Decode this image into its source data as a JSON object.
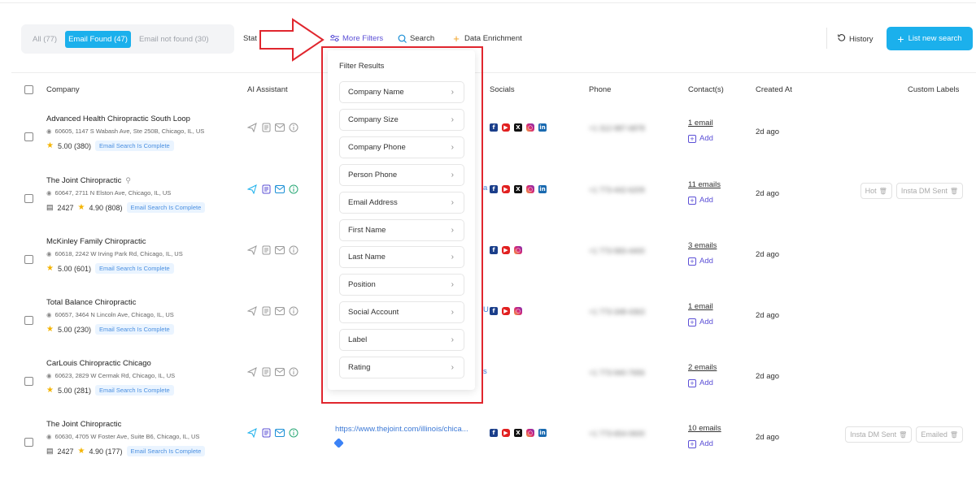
{
  "tabs": [
    {
      "label": "All (77)",
      "active": false
    },
    {
      "label": "Email Found (47)",
      "active": true
    },
    {
      "label": "Email not found (30)",
      "active": false
    }
  ],
  "status_label": "Stat",
  "toolbar": {
    "more_filters": "More Filters",
    "search": "Search",
    "data_enrichment": "Data Enrichment",
    "history": "History",
    "list_new_search": "List new search"
  },
  "columns": {
    "company": "Company",
    "ai_assistant": "AI Assistant",
    "socials": "Socials",
    "phone": "Phone",
    "contacts": "Contact(s)",
    "created_at": "Created At",
    "custom_labels": "Custom Labels"
  },
  "filter_panel": {
    "title": "Filter Results",
    "items": [
      "Company Name",
      "Company Size",
      "Company Phone",
      "Person Phone",
      "Email Address",
      "First Name",
      "Last Name",
      "Position",
      "Social Account",
      "Label",
      "Rating"
    ]
  },
  "rows": [
    {
      "name": "Advanced Health Chiropractic South Loop",
      "address": "60605, 1147 S Wabash Ave, Ste 250B, Chicago, IL, US",
      "employees": "",
      "rating": "5.00 (380)",
      "status": "Email Search Is Complete",
      "phone": "+1 312-987-6878",
      "contacts": "1 email",
      "add": "Add",
      "created": "2d ago",
      "labels": [],
      "website": ""
    },
    {
      "name": "The Joint Chiropractic",
      "address": "60647, 2711 N Elston Ave, Chicago, IL, US",
      "employees": "2427",
      "rating": "4.90 (808)",
      "status": "Email Search Is Complete",
      "phone": "+1 773-442-6209",
      "contacts": "11 emails",
      "add": "Add",
      "created": "2d ago",
      "labels": [
        "Hot",
        "Insta DM Sent"
      ],
      "website": ""
    },
    {
      "name": "McKinley Family Chiropractic",
      "address": "60618, 2242 W Irving Park Rd, Chicago, IL, US",
      "employees": "",
      "rating": "5.00 (601)",
      "status": "Email Search Is Complete",
      "phone": "+1 773-583-4400",
      "contacts": "3 emails",
      "add": "Add",
      "created": "2d ago",
      "labels": [],
      "website": ""
    },
    {
      "name": "Total Balance Chiropractic",
      "address": "60657, 3464 N Lincoln Ave, Chicago, IL, US",
      "employees": "",
      "rating": "5.00 (230)",
      "status": "Email Search Is Complete",
      "phone": "+1 773-348-4363",
      "contacts": "1 email",
      "add": "Add",
      "created": "2d ago",
      "labels": [],
      "website": ""
    },
    {
      "name": "CarLouis Chiropractic Chicago",
      "address": "60623, 2829 W Cermak Rd, Chicago, IL, US",
      "employees": "",
      "rating": "5.00 (281)",
      "status": "Email Search Is Complete",
      "phone": "+1 773-940-7656",
      "contacts": "2 emails",
      "add": "Add",
      "created": "2d ago",
      "labels": [],
      "website": ""
    },
    {
      "name": "The Joint Chiropractic",
      "address": "60630, 4705 W Foster Ave, Suite B6, Chicago, IL, US",
      "employees": "2427",
      "rating": "4.90 (177)",
      "status": "Email Search Is Complete",
      "phone": "+1 773-654-0600",
      "contacts": "10 emails",
      "add": "Add",
      "created": "2d ago",
      "labels": [
        "Insta DM Sent",
        "Emailed"
      ],
      "website": "https://www.thejoint.com/illinois/chica..."
    }
  ],
  "colors": {
    "accent": "#1bb0ec",
    "highlight": "#e0262e",
    "link": "#5b4fd6"
  }
}
